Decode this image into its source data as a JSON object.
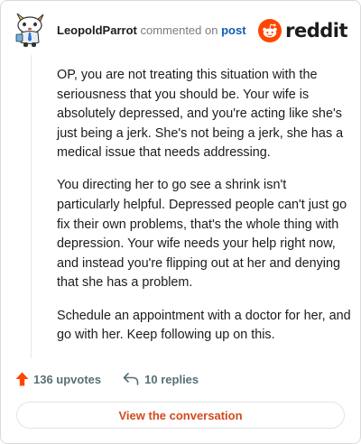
{
  "header": {
    "username": "LeopoldParrot",
    "verb": "commented on",
    "post_link": "post",
    "logo_text": "reddit",
    "avatar_icon": "snoo-avatar-icon",
    "logo_icon": "reddit-alien-icon",
    "brand_color": "#ff4500"
  },
  "comment": {
    "paragraphs": [
      "OP, you are not treating this situation with the seriousness that you should be. Your wife is absolutely depressed, and you're acting like she's just being a jerk. She's not being a jerk, she has a medical issue that needs addressing.",
      "You directing her to go see a shrink isn't particularly helpful. Depressed people can't just go fix their own problems, that's the whole thing with depression. Your wife needs your help right now, and instead you're flipping out at her and denying that she has a problem.",
      "Schedule an appointment with a doctor for her, and go with her. Keep following up on this."
    ]
  },
  "actions": {
    "upvotes": "136 upvotes",
    "replies": "10 replies",
    "upvote_icon": "upvote-arrow-icon",
    "reply_icon": "reply-icon",
    "upvote_color": "#ff4500"
  },
  "footer": {
    "view_button": "View the conversation",
    "view_button_color": "#d4491c"
  }
}
